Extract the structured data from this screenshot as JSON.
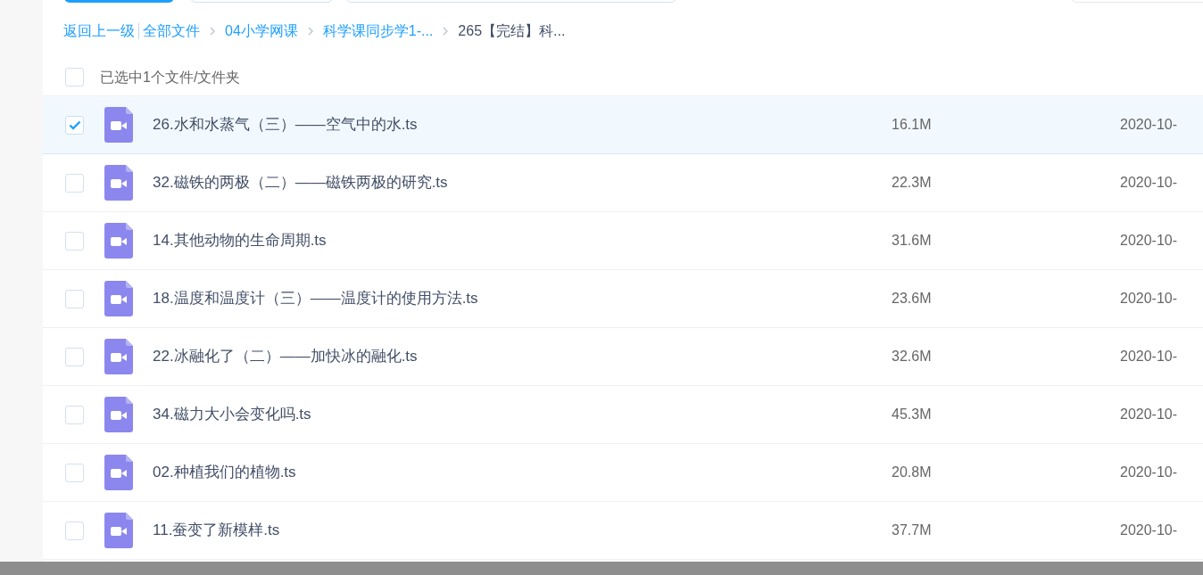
{
  "breadcrumb": {
    "back": "返回上一级",
    "items": [
      {
        "label": "全部文件",
        "kind": "link"
      },
      {
        "label": "04小学网课",
        "kind": "link"
      },
      {
        "label": "科学课同步学1-...",
        "kind": "link"
      },
      {
        "label": "265【完结】科...",
        "kind": "current"
      }
    ]
  },
  "selection": {
    "checked": false,
    "label": "已选中1个文件/文件夹"
  },
  "files": [
    {
      "name": "26.水和水蒸气（三）——空气中的水.ts",
      "size": "16.1M",
      "date": "2020-10-",
      "selected": true
    },
    {
      "name": "32.磁铁的两极（二）——磁铁两极的研究.ts",
      "size": "22.3M",
      "date": "2020-10-",
      "selected": false
    },
    {
      "name": "14.其他动物的生命周期.ts",
      "size": "31.6M",
      "date": "2020-10-",
      "selected": false
    },
    {
      "name": "18.温度和温度计（三）——温度计的使用方法.ts",
      "size": "23.6M",
      "date": "2020-10-",
      "selected": false
    },
    {
      "name": "22.冰融化了（二）——加快冰的融化.ts",
      "size": "32.6M",
      "date": "2020-10-",
      "selected": false
    },
    {
      "name": "34.磁力大小会变化吗.ts",
      "size": "45.3M",
      "date": "2020-10-",
      "selected": false
    },
    {
      "name": "02.种植我们的植物.ts",
      "size": "20.8M",
      "date": "2020-10-",
      "selected": false
    },
    {
      "name": "11.蚕变了新模样.ts",
      "size": "37.7M",
      "date": "2020-10-",
      "selected": false
    }
  ]
}
